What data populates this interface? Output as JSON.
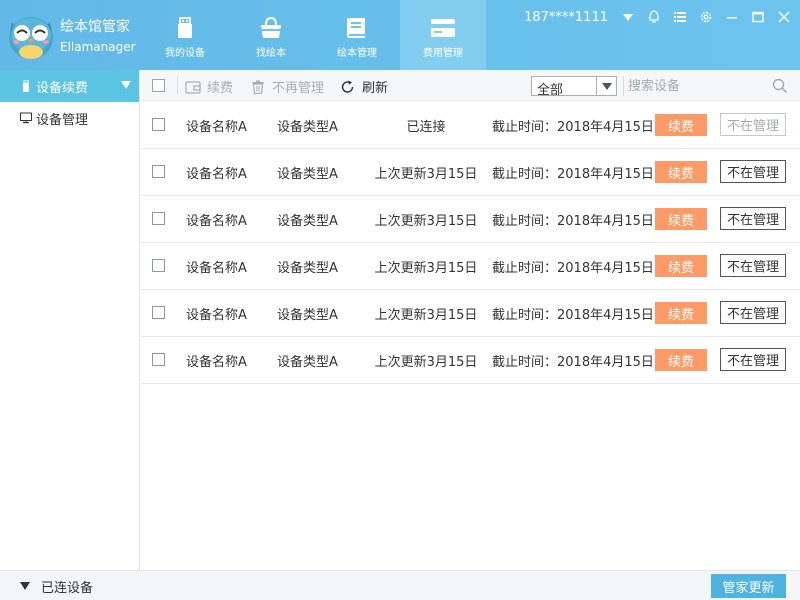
{
  "app": {
    "name_cn": "绘本馆管家",
    "name_en": "Ellamanager"
  },
  "nav": [
    {
      "label": "我的设备",
      "icon": "usb-device-icon"
    },
    {
      "label": "找绘本",
      "icon": "shopping-bag-icon"
    },
    {
      "label": "绘本管理",
      "icon": "book-icon"
    },
    {
      "label": "费用管理",
      "icon": "card-icon",
      "active": true
    }
  ],
  "user": {
    "phone": "187****1111"
  },
  "sidebar": {
    "items": [
      {
        "label": "设备续费",
        "active": true
      },
      {
        "label": "设备管理"
      }
    ]
  },
  "toolbar": {
    "renew_label": "续费",
    "unmanage_label": "不再管理",
    "refresh_label": "刷新",
    "filter_value": "全部",
    "search_placeholder": "搜索设备"
  },
  "devices": [
    {
      "name": "设备名称A",
      "type": "设备类型A",
      "status": "已连接",
      "deadline": "截止时间：2018年4月15日",
      "renew": "续费",
      "unmanage": "不在管理",
      "unmanage_disabled": true
    },
    {
      "name": "设备名称A",
      "type": "设备类型A",
      "status": "上次更新3月15日",
      "deadline": "截止时间：2018年4月15日",
      "renew": "续费",
      "unmanage": "不在管理"
    },
    {
      "name": "设备名称A",
      "type": "设备类型A",
      "status": "上次更新3月15日",
      "deadline": "截止时间：2018年4月15日",
      "renew": "续费",
      "unmanage": "不在管理"
    },
    {
      "name": "设备名称A",
      "type": "设备类型A",
      "status": "上次更新3月15日",
      "deadline": "截止时间：2018年4月15日",
      "renew": "续费",
      "unmanage": "不在管理"
    },
    {
      "name": "设备名称A",
      "type": "设备类型A",
      "status": "上次更新3月15日",
      "deadline": "截止时间：2018年4月15日",
      "renew": "续费",
      "unmanage": "不在管理"
    },
    {
      "name": "设备名称A",
      "type": "设备类型A",
      "status": "上次更新3月15日",
      "deadline": "截止时间：2018年4月15日",
      "renew": "续费",
      "unmanage": "不在管理"
    }
  ],
  "footer": {
    "connected_label": "已连设备",
    "update_label": "管家更新"
  },
  "colors": {
    "header": "#62b9e8",
    "nav_active": "#83cdf0",
    "sidebar_active": "#5bc4e3",
    "renew_button": "#fd9a66",
    "update_button": "#4fb3e1"
  }
}
